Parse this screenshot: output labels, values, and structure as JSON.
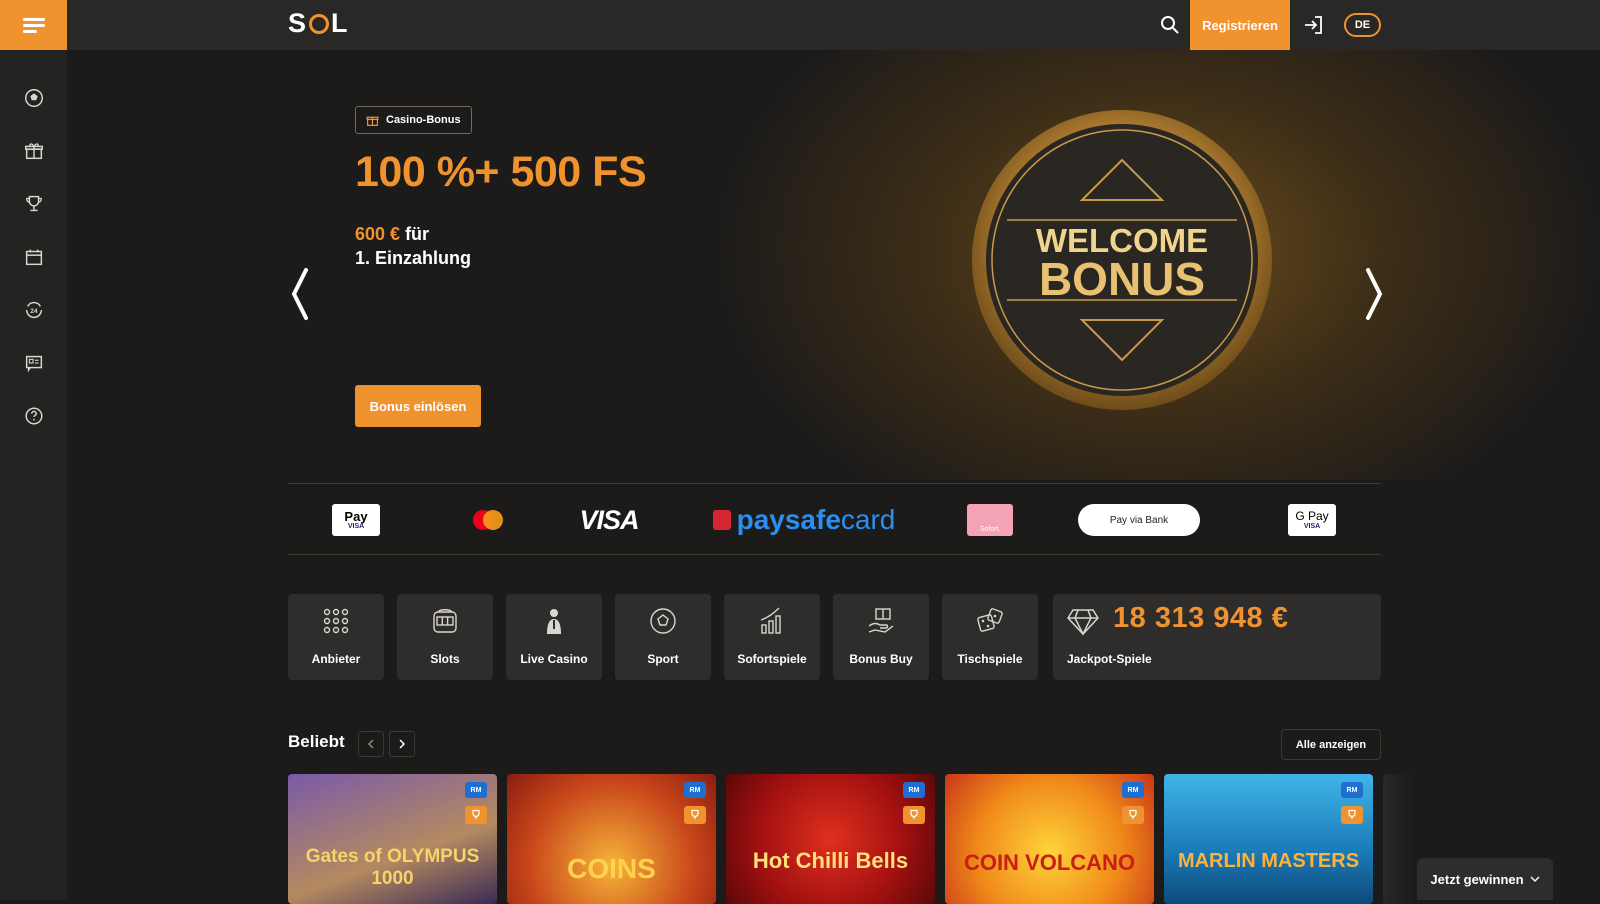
{
  "header": {
    "logo_left": "S",
    "logo_right": "L",
    "register_label": "Registrieren",
    "lang_label": "DE"
  },
  "sidebar": {
    "items": [
      "soccer-ball-icon",
      "gift-icon",
      "trophy-icon",
      "calendar-icon",
      "support-24-icon",
      "news-icon",
      "help-icon"
    ]
  },
  "hero": {
    "badge": "Casino-Bonus",
    "headline": "100 %+ 500 FS",
    "amount": "600 €",
    "amount_suffix": "für",
    "line2": "1. Einzahlung",
    "button": "Bonus einlösen",
    "coin_line1": "WELCOME",
    "coin_line2": "BONUS"
  },
  "payments": {
    "apple_pay": "Pay",
    "visa": "VISA",
    "paysafe_a": "paysafe",
    "paysafe_b": "card",
    "sofort": "Sofort.",
    "pay_via_bank": "Pay via Bank",
    "google_pay": "G Pay",
    "card_visa": "VISA"
  },
  "categories": [
    {
      "label": "Anbieter"
    },
    {
      "label": "Slots"
    },
    {
      "label": "Live Casino"
    },
    {
      "label": "Sport"
    },
    {
      "label": "Sofortspiele"
    },
    {
      "label": "Bonus Buy"
    },
    {
      "label": "Tischspiele"
    }
  ],
  "jackpot": {
    "amount": "18 313 948 €",
    "label": "Jackpot-Spiele"
  },
  "popular": {
    "title": "Beliebt",
    "all_label": "Alle anzeigen",
    "games": [
      {
        "title": "Gates of OLYMPUS 1000",
        "badge": "RM"
      },
      {
        "title": "COINS",
        "badge": "RM"
      },
      {
        "title": "Hot Chilli Bells",
        "badge": "RM"
      },
      {
        "title": "COIN VOLCANO",
        "badge": "RM"
      },
      {
        "title": "MARLIN MASTERS",
        "badge": "RM"
      }
    ]
  },
  "win_button": "Jetzt gewinnen",
  "colors": {
    "accent": "#f0922e",
    "bg": "#1c1b1a",
    "panel": "#2f2d2b"
  }
}
